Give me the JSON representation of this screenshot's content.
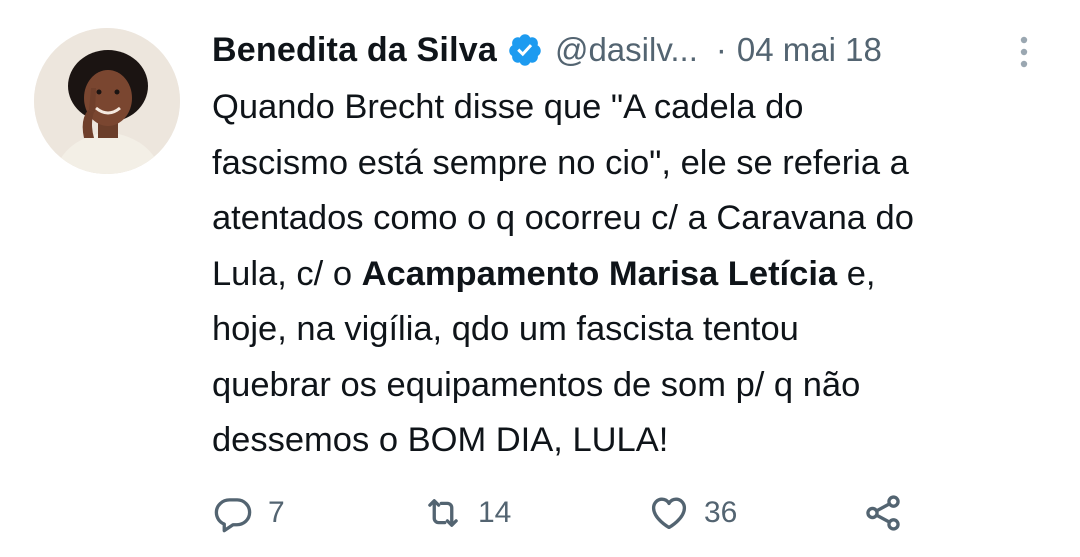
{
  "tweet": {
    "author": {
      "display_name": "Benedita da Silva",
      "handle": "@dasilv...",
      "verified": true
    },
    "separator": "·",
    "date": "04 mai 18",
    "body_lines": [
      {
        "text": "Quando Brecht disse que \"A cadela do"
      },
      {
        "text": "fascismo está sempre no cio\", ele se referia a"
      },
      {
        "text": "atentados como o q ocorreu c/ a Caravana do"
      },
      {
        "prefix": "Lula, c/ o ",
        "bold": "Acampamento Marisa Letícia",
        "suffix": " e,"
      },
      {
        "text": "hoje, na vigília, qdo um fascista tentou"
      },
      {
        "text": "quebrar os equipamentos de som p/ q não"
      },
      {
        "text": "dessemos o BOM DIA, LULA!"
      }
    ],
    "actions": {
      "reply": {
        "icon": "reply-icon",
        "count": "7"
      },
      "retweet": {
        "icon": "retweet-icon",
        "count": "14"
      },
      "like": {
        "icon": "heart-icon",
        "count": "36"
      },
      "share": {
        "icon": "share-icon"
      }
    }
  },
  "colors": {
    "text": "#0f1419",
    "secondary": "#536471",
    "verified_badge": "#1d9bf0",
    "background": "#ffffff"
  }
}
